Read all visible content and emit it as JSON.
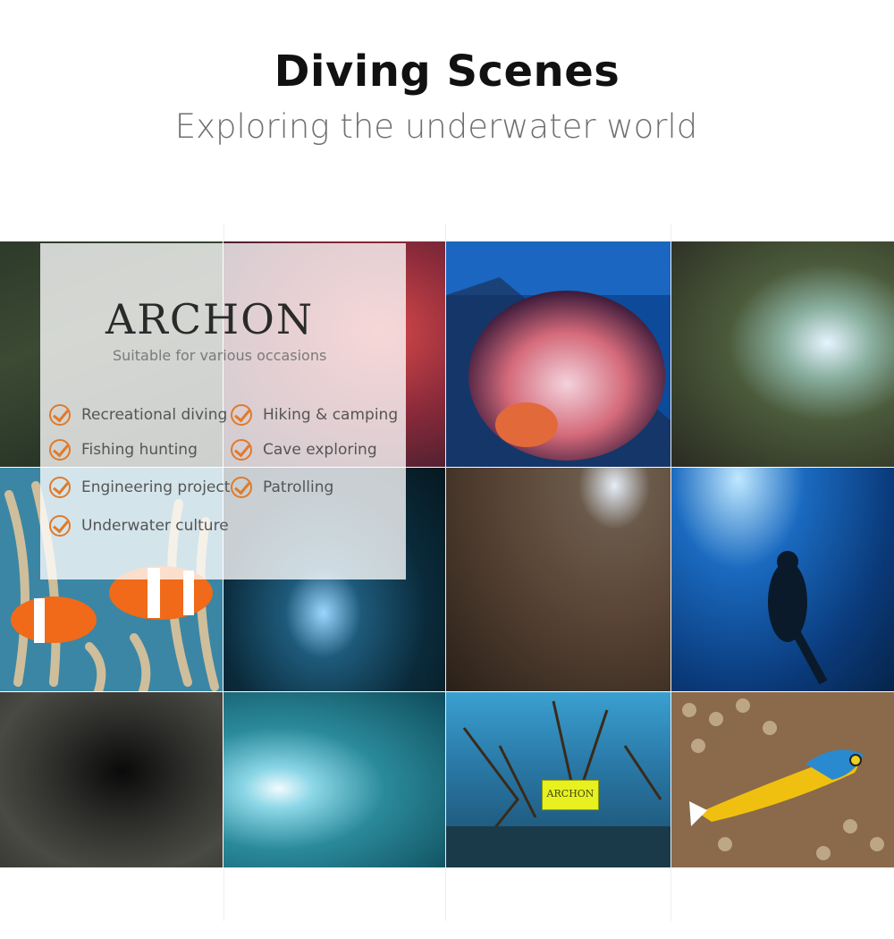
{
  "header": {
    "title": "Diving Scenes",
    "subtitle": "Exploring the underwater world"
  },
  "overlay": {
    "brand": "ARCHON",
    "tagline": "Suitable for various occasions",
    "uses": [
      "Recreational diving",
      "Hiking & camping",
      "Fishing hunting",
      "Cave exploring",
      "Engineering project",
      "Patrolling",
      "Underwater culture"
    ]
  },
  "photos": {
    "sign_text": "ARCHON"
  },
  "colors": {
    "accent": "#e07a2a"
  }
}
